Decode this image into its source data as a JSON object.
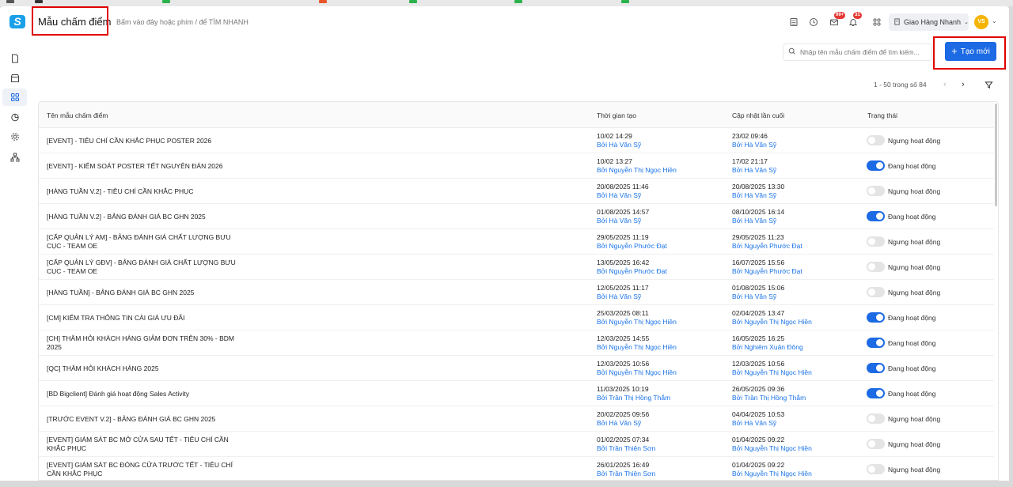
{
  "app": {
    "logo_letter": "S",
    "page_title": "Mẫu chấm điểm",
    "breadcrumb": "Bấm vào đây hoặc phím / để TÌM NHANH"
  },
  "header": {
    "mail_badge": "99+",
    "notification_badge": "31",
    "company": "Giao Hàng Nhanh",
    "avatar_initials": "VS"
  },
  "toolbar": {
    "search_placeholder": "Nhập tên mẫu chấm điểm để tìm kiếm...",
    "create_label": "Tạo mới"
  },
  "pagination": {
    "range_text": "1 - 50 trong số 84"
  },
  "table": {
    "columns": [
      "Tên mẫu chấm điểm",
      "Thời gian tạo",
      "Cập nhật lần cuối",
      "Trạng thái"
    ],
    "by_prefix": "Bởi",
    "rows": [
      {
        "name": "[EVENT] - TIÊU CHÍ CẦN KHẮC PHỤC POSTER 2026",
        "created": "10/02 14:29",
        "created_by": "Hà Văn Sỹ",
        "updated": "23/02 09:46",
        "updated_by": "Hà Văn Sỹ",
        "active": false,
        "status": "Ngưng hoạt động"
      },
      {
        "name": "[EVENT] - KIỂM SOÁT POSTER TẾT NGUYÊN ĐÁN 2026",
        "created": "10/02 13:27",
        "created_by": "Nguyễn Thị Ngọc Hiền",
        "updated": "17/02 21:17",
        "updated_by": "Hà Văn Sỹ",
        "active": true,
        "status": "Đang hoạt động"
      },
      {
        "name": "[HÀNG TUẦN V.2] - TIÊU CHÍ CẦN KHẮC PHỤC",
        "created": "20/08/2025 11:46",
        "created_by": "Hà Văn Sỹ",
        "updated": "20/08/2025 13:30",
        "updated_by": "Hà Văn Sỹ",
        "active": false,
        "status": "Ngưng hoạt động"
      },
      {
        "name": "[HÀNG TUẦN V.2] - BẢNG ĐÁNH GIÁ BC GHN 2025",
        "created": "01/08/2025 14:57",
        "created_by": "Hà Văn Sỹ",
        "updated": "08/10/2025 16:14",
        "updated_by": "Hà Văn Sỹ",
        "active": true,
        "status": "Đang hoạt động"
      },
      {
        "name": "[CẤP QUẢN LÝ AM] - BẢNG ĐÁNH GIÁ CHẤT LƯỢNG BƯU CỤC - TEAM OE",
        "created": "29/05/2025 11:19",
        "created_by": "Nguyễn Phước Đạt",
        "updated": "29/05/2025 11:23",
        "updated_by": "Nguyễn Phước Đạt",
        "active": false,
        "status": "Ngưng hoạt động"
      },
      {
        "name": "[CẤP QUẢN LÝ GĐV] - BẢNG ĐÁNH GIÁ CHẤT LƯỢNG BƯU CỤC - TEAM OE",
        "created": "13/05/2025 16:42",
        "created_by": "Nguyễn Phước Đạt",
        "updated": "16/07/2025 15:56",
        "updated_by": "Nguyễn Phước Đạt",
        "active": false,
        "status": "Ngưng hoạt động"
      },
      {
        "name": "[HÀNG TUẦN] - BẢNG ĐÁNH GIÁ BC GHN 2025",
        "created": "12/05/2025 11:17",
        "created_by": "Hà Văn Sỹ",
        "updated": "01/08/2025 15:06",
        "updated_by": "Hà Văn Sỹ",
        "active": false,
        "status": "Ngưng hoạt động"
      },
      {
        "name": "[CM] KIỂM TRA THÔNG TIN CÀI GIÁ ƯU ĐÃI",
        "created": "25/03/2025 08:11",
        "created_by": "Nguyễn Thị Ngọc Hiền",
        "updated": "02/04/2025 13:47",
        "updated_by": "Nguyễn Thị Ngọc Hiền",
        "active": true,
        "status": "Đang hoạt động"
      },
      {
        "name": "[CH] THĂM HỎI KHÁCH HÀNG GIẢM ĐƠN TRÊN 30% - BDM 2025",
        "created": "12/03/2025 14:55",
        "created_by": "Nguyễn Thị Ngọc Hiền",
        "updated": "16/05/2025 16:25",
        "updated_by": "Nghiêm Xuân Đông",
        "active": true,
        "status": "Đang hoạt động"
      },
      {
        "name": "[QC] THĂM HỎI KHÁCH HÀNG 2025",
        "created": "12/03/2025 10:56",
        "created_by": "Nguyễn Thị Ngọc Hiền",
        "updated": "12/03/2025 10:56",
        "updated_by": "Nguyễn Thị Ngọc Hiền",
        "active": true,
        "status": "Đang hoạt động"
      },
      {
        "name": "[BD Bigclient] Đánh giá hoạt động Sales Activity",
        "created": "11/03/2025 10:19",
        "created_by": "Trần Thị Hồng Thắm",
        "updated": "26/05/2025 09:36",
        "updated_by": "Trần Thị Hồng Thắm",
        "active": true,
        "status": "Đang hoạt động"
      },
      {
        "name": "[TRƯỚC EVENT V.2] - BẢNG ĐÁNH GIÁ BC GHN 2025",
        "created": "20/02/2025 09:56",
        "created_by": "Hà Văn Sỹ",
        "updated": "04/04/2025 10:53",
        "updated_by": "Hà Văn Sỹ",
        "active": false,
        "status": "Ngưng hoạt động"
      },
      {
        "name": "[EVENT] GIÁM SÁT BC MỞ CỬA SAU TẾT - TIÊU CHÍ CẦN KHẮC PHỤC",
        "created": "01/02/2025 07:34",
        "created_by": "Trần Thiện Sơn",
        "updated": "01/04/2025 09:22",
        "updated_by": "Nguyễn Thị Ngọc Hiền",
        "active": false,
        "status": "Ngưng hoạt động"
      },
      {
        "name": "[EVENT] GIÁM SÁT BC ĐÓNG CỬA TRƯỚC TẾT - TIÊU CHÍ CẦN KHẮC PHỤC",
        "created": "26/01/2025 16:49",
        "created_by": "Trần Thiện Sơn",
        "updated": "01/04/2025 09:22",
        "updated_by": "Nguyễn Thị Ngọc Hiền",
        "active": false,
        "status": "Ngưng hoạt động"
      }
    ]
  },
  "colors": {
    "primary": "#1c6ae4",
    "link": "#1a73e8",
    "highlight": "#e00000",
    "logo": "#1aa0e8",
    "avatar": "#f5b400"
  }
}
